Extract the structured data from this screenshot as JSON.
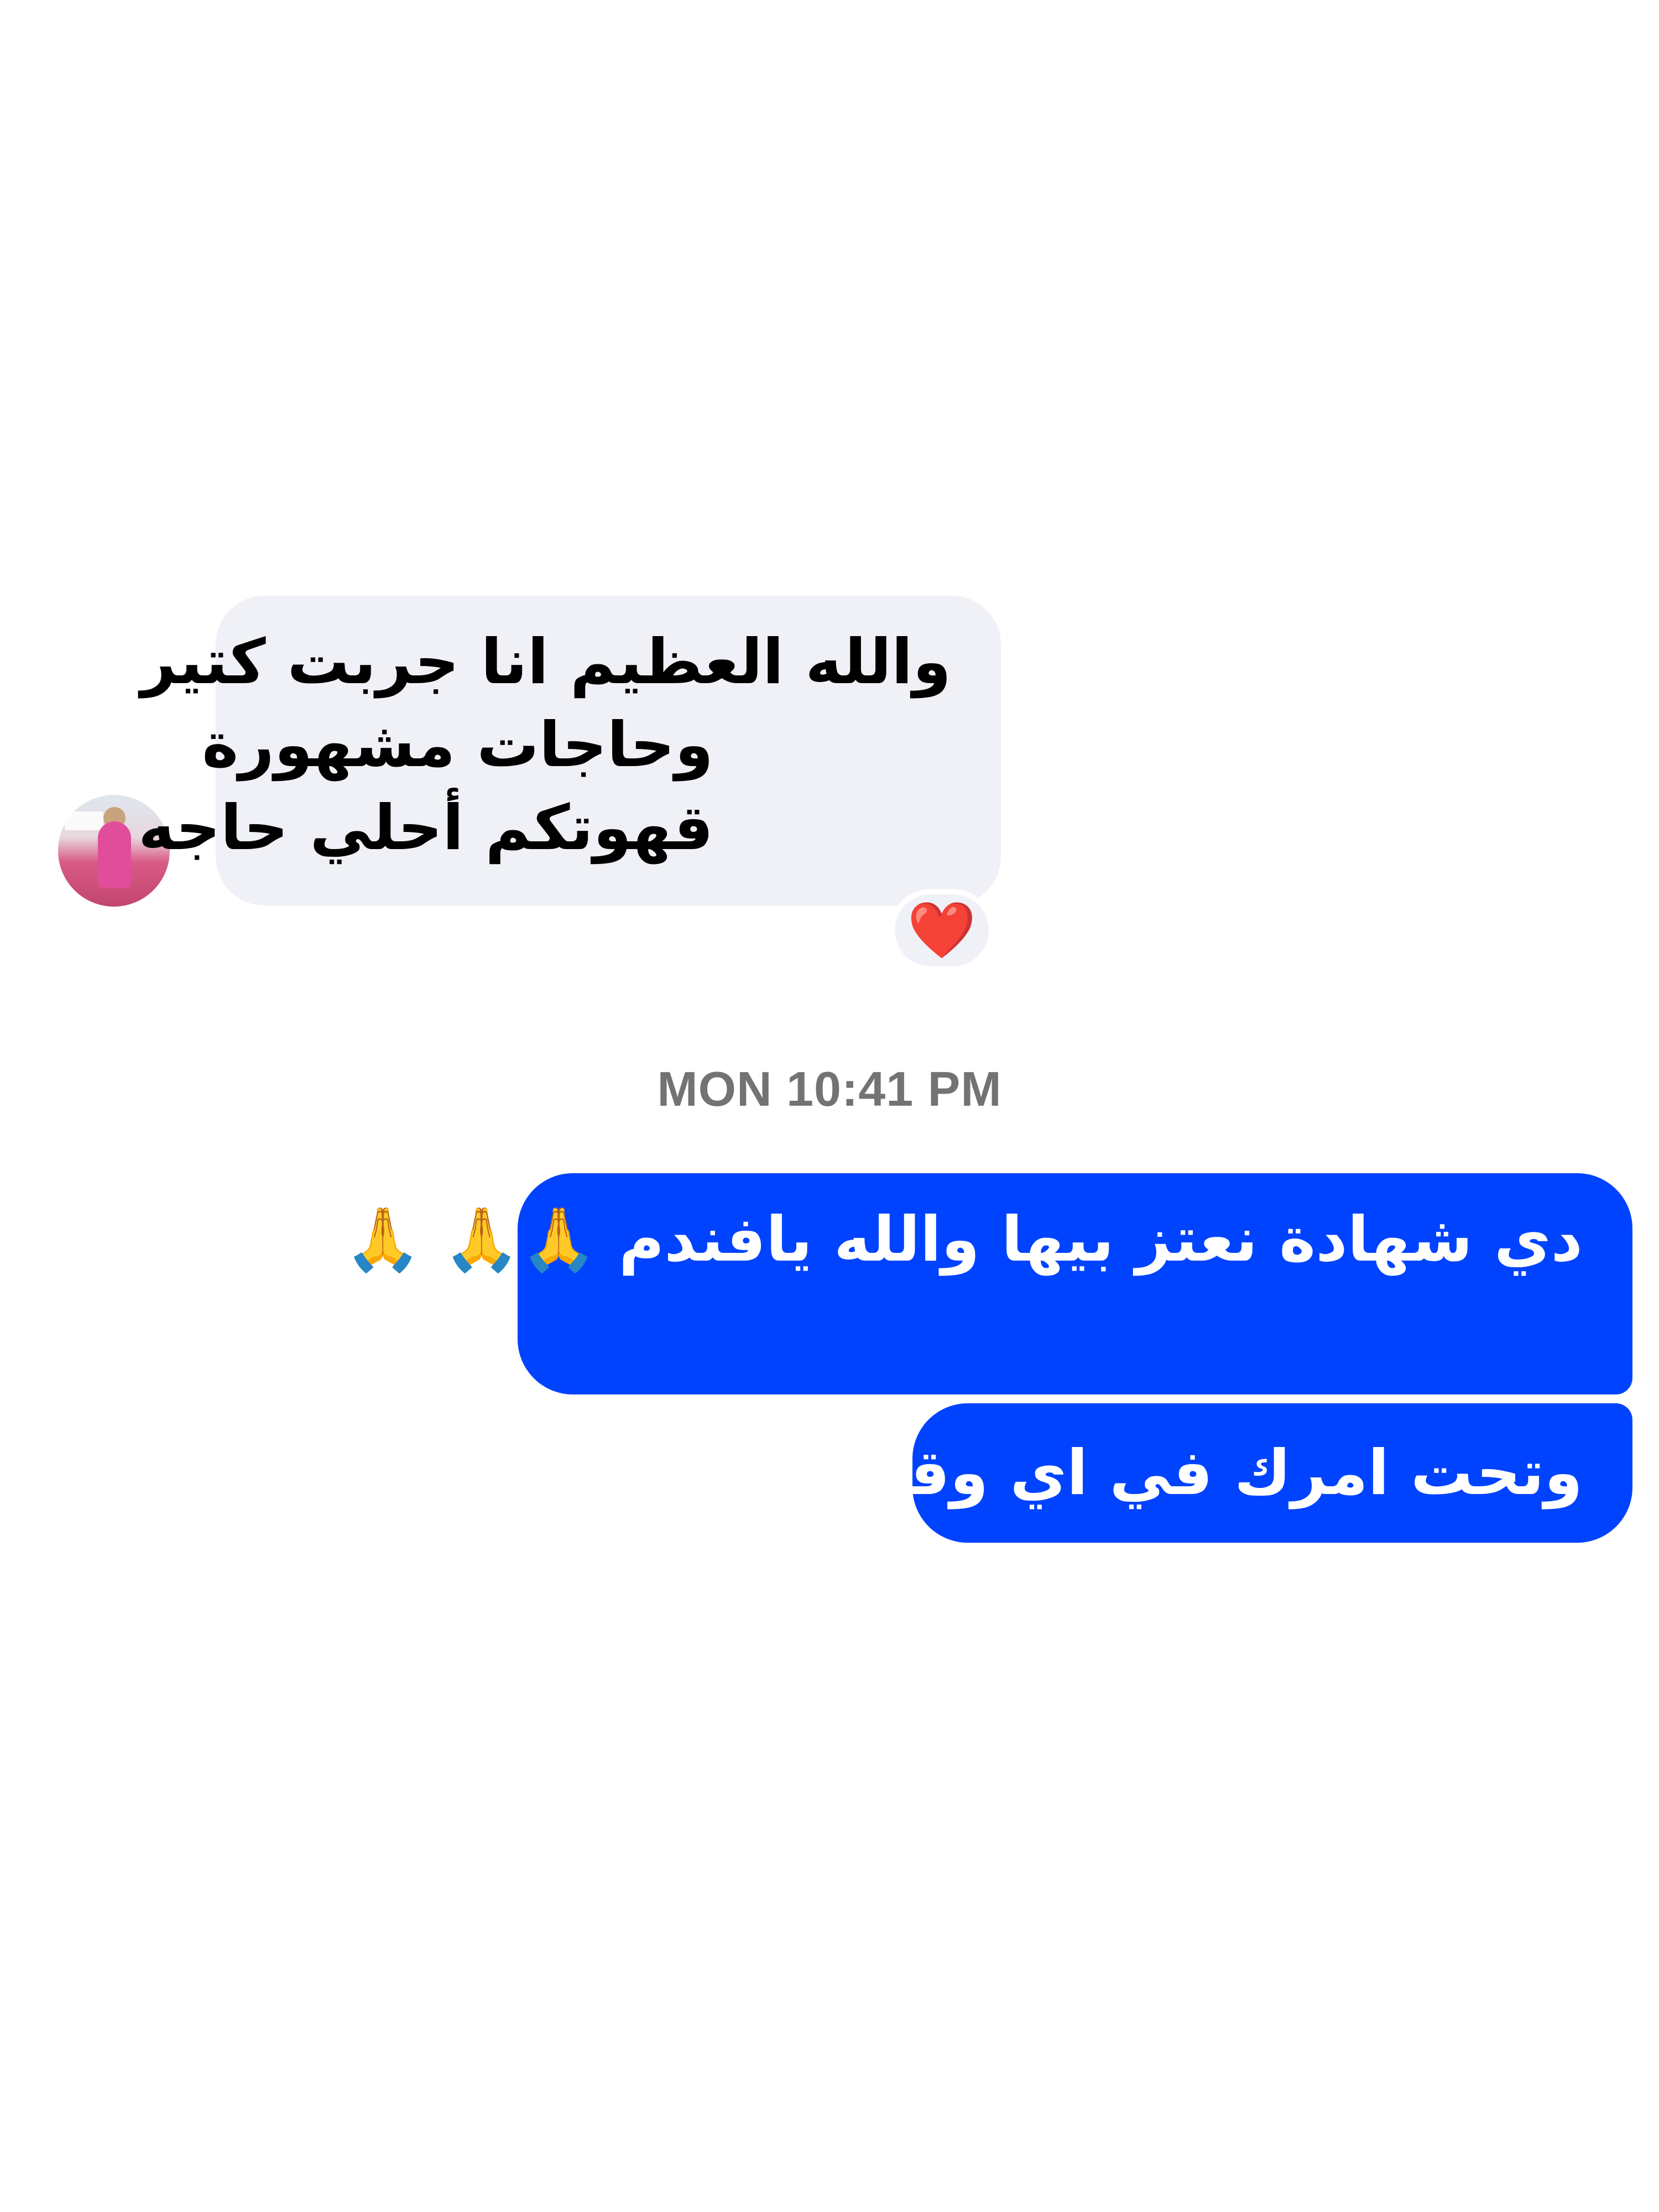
{
  "thread": {
    "incoming": {
      "lines": [
        "والله العظيم انا جربت كتير",
        "وحاجات مشهورة",
        "قهوتكم أحلي حاجه"
      ],
      "reaction": "❤️"
    },
    "timestamp": "MON 10:41 PM",
    "outgoing": [
      {
        "text": "دي شهادة نعتز بيها والله يافندم 🙏🙏 🙏"
      },
      {
        "text": "وتحت امرك في اي وقت"
      }
    ]
  },
  "colors": {
    "incoming_bubble": "#f0f1f6",
    "outgoing_bubble": "#0043ff",
    "timestamp": "#737373",
    "background": "#ffffff"
  }
}
